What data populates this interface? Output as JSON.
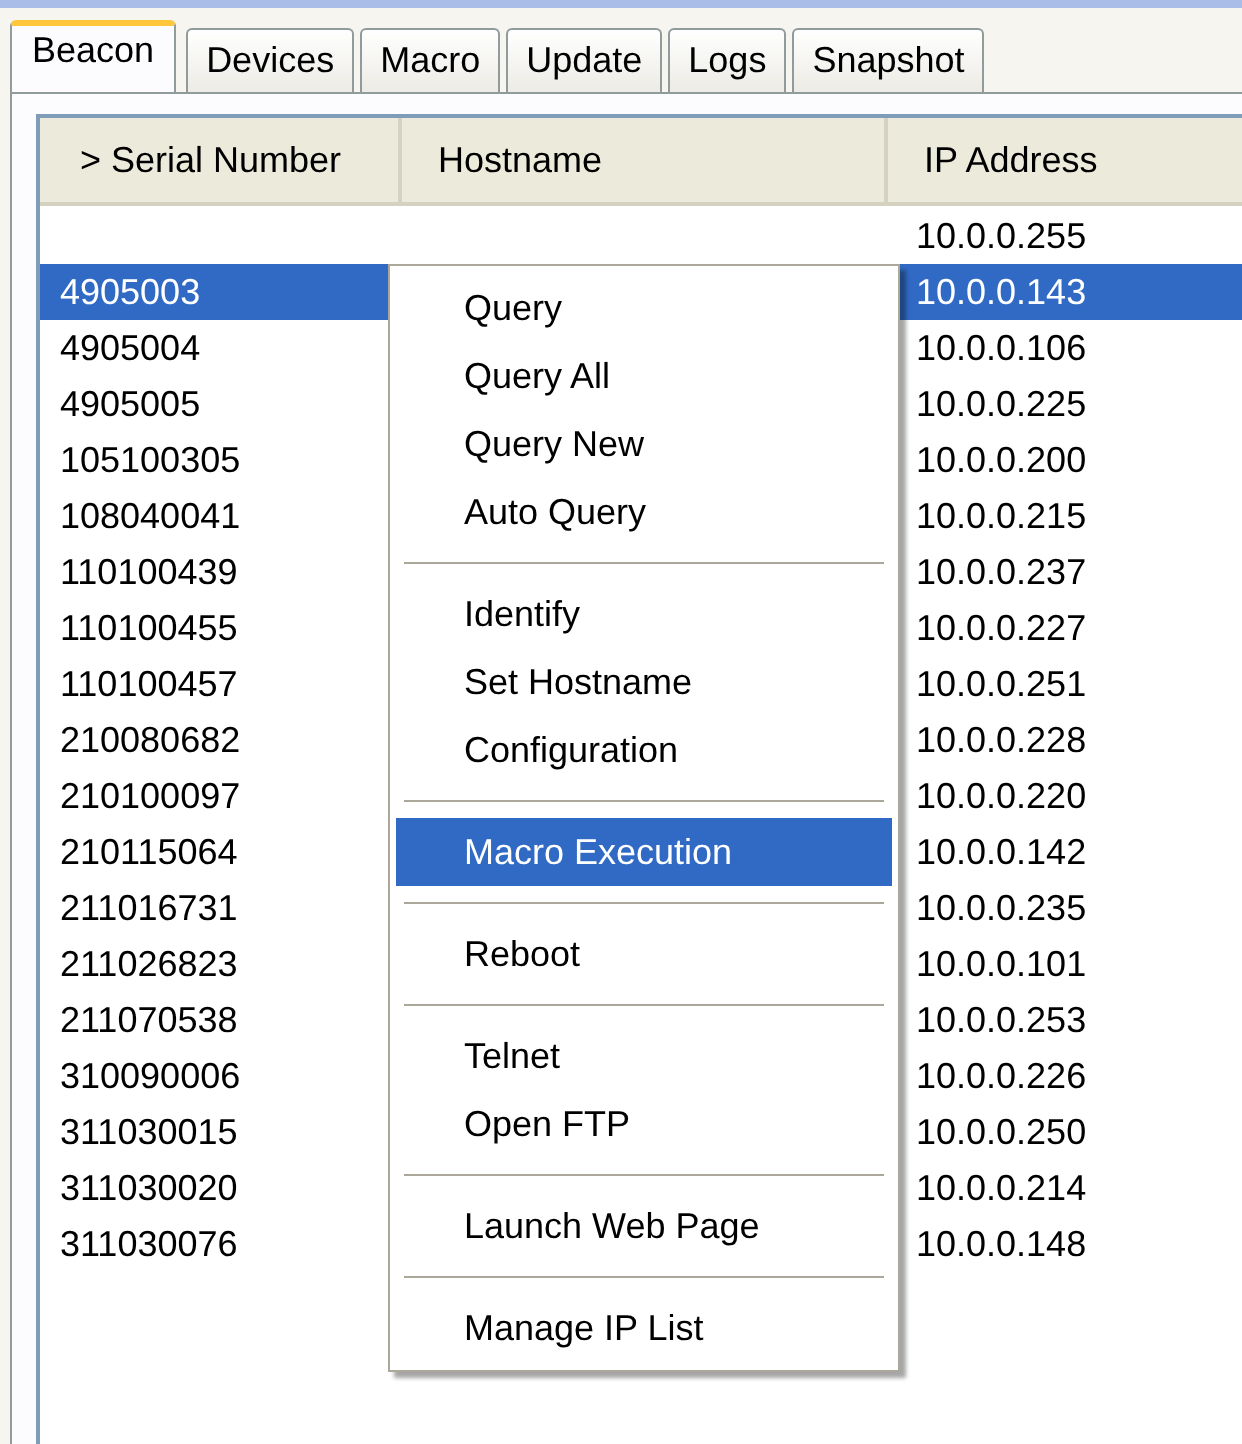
{
  "tabs": [
    {
      "label": "Beacon",
      "selected": true
    },
    {
      "label": "Devices",
      "selected": false
    },
    {
      "label": "Macro",
      "selected": false
    },
    {
      "label": "Update",
      "selected": false
    },
    {
      "label": "Logs",
      "selected": false
    },
    {
      "label": "Snapshot",
      "selected": false
    }
  ],
  "table": {
    "columns": [
      "> Serial Number",
      "Hostname",
      "IP Address"
    ],
    "rows": [
      {
        "ip": "10.0.0.255",
        "selected": false
      },
      {
        "serial": "4905003",
        "ip": "10.0.0.143",
        "selected": true
      },
      {
        "serial": "4905004",
        "ip": "10.0.0.106",
        "selected": false
      },
      {
        "serial": "4905005",
        "ip": "10.0.0.225",
        "selected": false
      },
      {
        "serial": "105100305",
        "ip": "10.0.0.200",
        "selected": false
      },
      {
        "serial": "108040041",
        "ip": "10.0.0.215",
        "selected": false
      },
      {
        "serial": "110100439",
        "ip": "10.0.0.237",
        "selected": false
      },
      {
        "serial": "110100455",
        "ip": "10.0.0.227",
        "selected": false
      },
      {
        "serial": "110100457",
        "ip": "10.0.0.251",
        "selected": false
      },
      {
        "serial": "210080682",
        "ip": "10.0.0.228",
        "selected": false
      },
      {
        "serial": "210100097",
        "ip": "10.0.0.220",
        "selected": false
      },
      {
        "serial": "210115064",
        "ip": "10.0.0.142",
        "selected": false
      },
      {
        "serial": "211016731",
        "ip": "10.0.0.235",
        "selected": false
      },
      {
        "serial": "211026823",
        "ip": "10.0.0.101",
        "selected": false
      },
      {
        "serial": "211070538",
        "ip": "10.0.0.253",
        "selected": false
      },
      {
        "serial": "310090006",
        "ip": "10.0.0.226",
        "selected": false
      },
      {
        "serial": "311030015",
        "ip": "10.0.0.250",
        "selected": false
      },
      {
        "serial": "311030020",
        "ip": "10.0.0.214",
        "selected": false
      },
      {
        "serial": "311030076",
        "ip": "10.0.0.148",
        "selected": false
      }
    ]
  },
  "context_menu": {
    "items": [
      {
        "kind": "item",
        "label": "Query",
        "selected": false
      },
      {
        "kind": "item",
        "label": "Query All",
        "selected": false
      },
      {
        "kind": "item",
        "label": "Query New",
        "selected": false
      },
      {
        "kind": "item",
        "label": "Auto Query",
        "selected": false
      },
      {
        "kind": "separator"
      },
      {
        "kind": "item",
        "label": "Identify",
        "selected": false
      },
      {
        "kind": "item",
        "label": "Set Hostname",
        "selected": false
      },
      {
        "kind": "item",
        "label": "Configuration",
        "selected": false
      },
      {
        "kind": "separator"
      },
      {
        "kind": "item",
        "label": "Macro Execution",
        "selected": true
      },
      {
        "kind": "separator"
      },
      {
        "kind": "item",
        "label": "Reboot",
        "selected": false
      },
      {
        "kind": "separator"
      },
      {
        "kind": "item",
        "label": "Telnet",
        "selected": false
      },
      {
        "kind": "item",
        "label": "Open FTP",
        "selected": false
      },
      {
        "kind": "separator"
      },
      {
        "kind": "item",
        "label": "Launch Web Page",
        "selected": false
      },
      {
        "kind": "separator"
      },
      {
        "kind": "item",
        "label": "Manage IP List",
        "selected": false
      }
    ]
  }
}
